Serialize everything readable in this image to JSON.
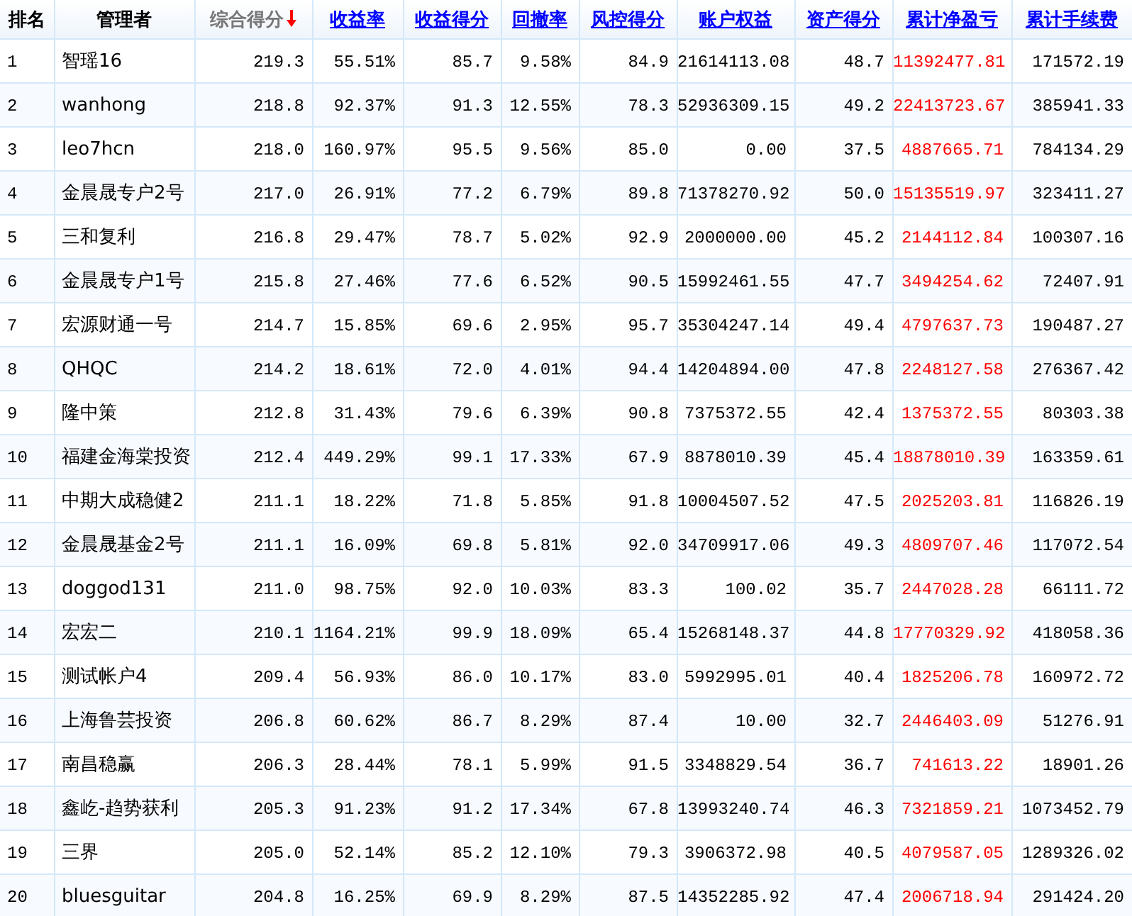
{
  "table": {
    "columns": [
      {
        "label": "排名",
        "kind": "plain",
        "highlighted": false
      },
      {
        "label": "管理者",
        "kind": "plain",
        "highlighted": false
      },
      {
        "label": "综合得分",
        "kind": "sorted",
        "highlighted": false
      },
      {
        "label": "收益率",
        "kind": "link",
        "highlighted": false
      },
      {
        "label": "收益得分",
        "kind": "link",
        "highlighted": false
      },
      {
        "label": "回撤率",
        "kind": "link",
        "highlighted": false
      },
      {
        "label": "风控得分",
        "kind": "link",
        "highlighted": false
      },
      {
        "label": "账户权益",
        "kind": "link",
        "highlighted": false
      },
      {
        "label": "资产得分",
        "kind": "link",
        "highlighted": false
      },
      {
        "label": "累计净盈亏",
        "kind": "link",
        "highlighted": true
      },
      {
        "label": "累计手续费",
        "kind": "link",
        "highlighted": false
      }
    ],
    "rows": [
      [
        "1",
        "智瑶16",
        "219.3",
        "55.51%",
        "85.7",
        "9.58%",
        "84.9",
        "21614113.08",
        "48.7",
        "11392477.81",
        "171572.19"
      ],
      [
        "2",
        "wanhong",
        "218.8",
        "92.37%",
        "91.3",
        "12.55%",
        "78.3",
        "52936309.15",
        "49.2",
        "22413723.67",
        "385941.33"
      ],
      [
        "3",
        "leo7hcn",
        "218.0",
        "160.97%",
        "95.5",
        "9.56%",
        "85.0",
        "0.00",
        "37.5",
        "4887665.71",
        "784134.29"
      ],
      [
        "4",
        "金晨晟专户2号",
        "217.0",
        "26.91%",
        "77.2",
        "6.79%",
        "89.8",
        "71378270.92",
        "50.0",
        "15135519.97",
        "323411.27"
      ],
      [
        "5",
        "三和复利",
        "216.8",
        "29.47%",
        "78.7",
        "5.02%",
        "92.9",
        "2000000.00",
        "45.2",
        "2144112.84",
        "100307.16"
      ],
      [
        "6",
        "金晨晟专户1号",
        "215.8",
        "27.46%",
        "77.6",
        "6.52%",
        "90.5",
        "15992461.55",
        "47.7",
        "3494254.62",
        "72407.91"
      ],
      [
        "7",
        "宏源财通一号",
        "214.7",
        "15.85%",
        "69.6",
        "2.95%",
        "95.7",
        "35304247.14",
        "49.4",
        "4797637.73",
        "190487.27"
      ],
      [
        "8",
        "QHQC",
        "214.2",
        "18.61%",
        "72.0",
        "4.01%",
        "94.4",
        "14204894.00",
        "47.8",
        "2248127.58",
        "276367.42"
      ],
      [
        "9",
        "隆中策",
        "212.8",
        "31.43%",
        "79.6",
        "6.39%",
        "90.8",
        "7375372.55",
        "42.4",
        "1375372.55",
        "80303.38"
      ],
      [
        "10",
        "福建金海棠投资",
        "212.4",
        "449.29%",
        "99.1",
        "17.33%",
        "67.9",
        "8878010.39",
        "45.4",
        "18878010.39",
        "163359.61"
      ],
      [
        "11",
        "中期大成稳健2",
        "211.1",
        "18.22%",
        "71.8",
        "5.85%",
        "91.8",
        "10004507.52",
        "47.5",
        "2025203.81",
        "116826.19"
      ],
      [
        "12",
        "金晨晟基金2号",
        "211.1",
        "16.09%",
        "69.8",
        "5.81%",
        "92.0",
        "34709917.06",
        "49.3",
        "4809707.46",
        "117072.54"
      ],
      [
        "13",
        "doggod131",
        "211.0",
        "98.75%",
        "92.0",
        "10.03%",
        "83.3",
        "100.02",
        "35.7",
        "2447028.28",
        "66111.72"
      ],
      [
        "14",
        "宏宏二",
        "210.1",
        "1164.21%",
        "99.9",
        "18.09%",
        "65.4",
        "15268148.37",
        "44.8",
        "17770329.92",
        "418058.36"
      ],
      [
        "15",
        "测试帐户4",
        "209.4",
        "56.93%",
        "86.0",
        "10.17%",
        "83.0",
        "5992995.01",
        "40.4",
        "1825206.78",
        "160972.72"
      ],
      [
        "16",
        "上海鲁芸投资",
        "206.8",
        "60.62%",
        "86.7",
        "8.29%",
        "87.4",
        "10.00",
        "32.7",
        "2446403.09",
        "51276.91"
      ],
      [
        "17",
        "南昌稳赢",
        "206.3",
        "28.44%",
        "78.1",
        "5.99%",
        "91.5",
        "3348829.54",
        "36.7",
        "741613.22",
        "18901.26"
      ],
      [
        "18",
        "鑫屹-趋势获利",
        "205.3",
        "91.23%",
        "91.2",
        "17.34%",
        "67.8",
        "13993240.74",
        "46.3",
        "7321859.21",
        "1073452.79"
      ],
      [
        "19",
        "三界",
        "205.0",
        "52.14%",
        "85.2",
        "12.10%",
        "79.3",
        "3906372.98",
        "40.5",
        "4079587.05",
        "1289326.02"
      ],
      [
        "20",
        "bluesguitar",
        "204.8",
        "16.25%",
        "69.9",
        "8.29%",
        "87.5",
        "14352285.92",
        "47.4",
        "2006718.94",
        "291424.20"
      ]
    ]
  }
}
